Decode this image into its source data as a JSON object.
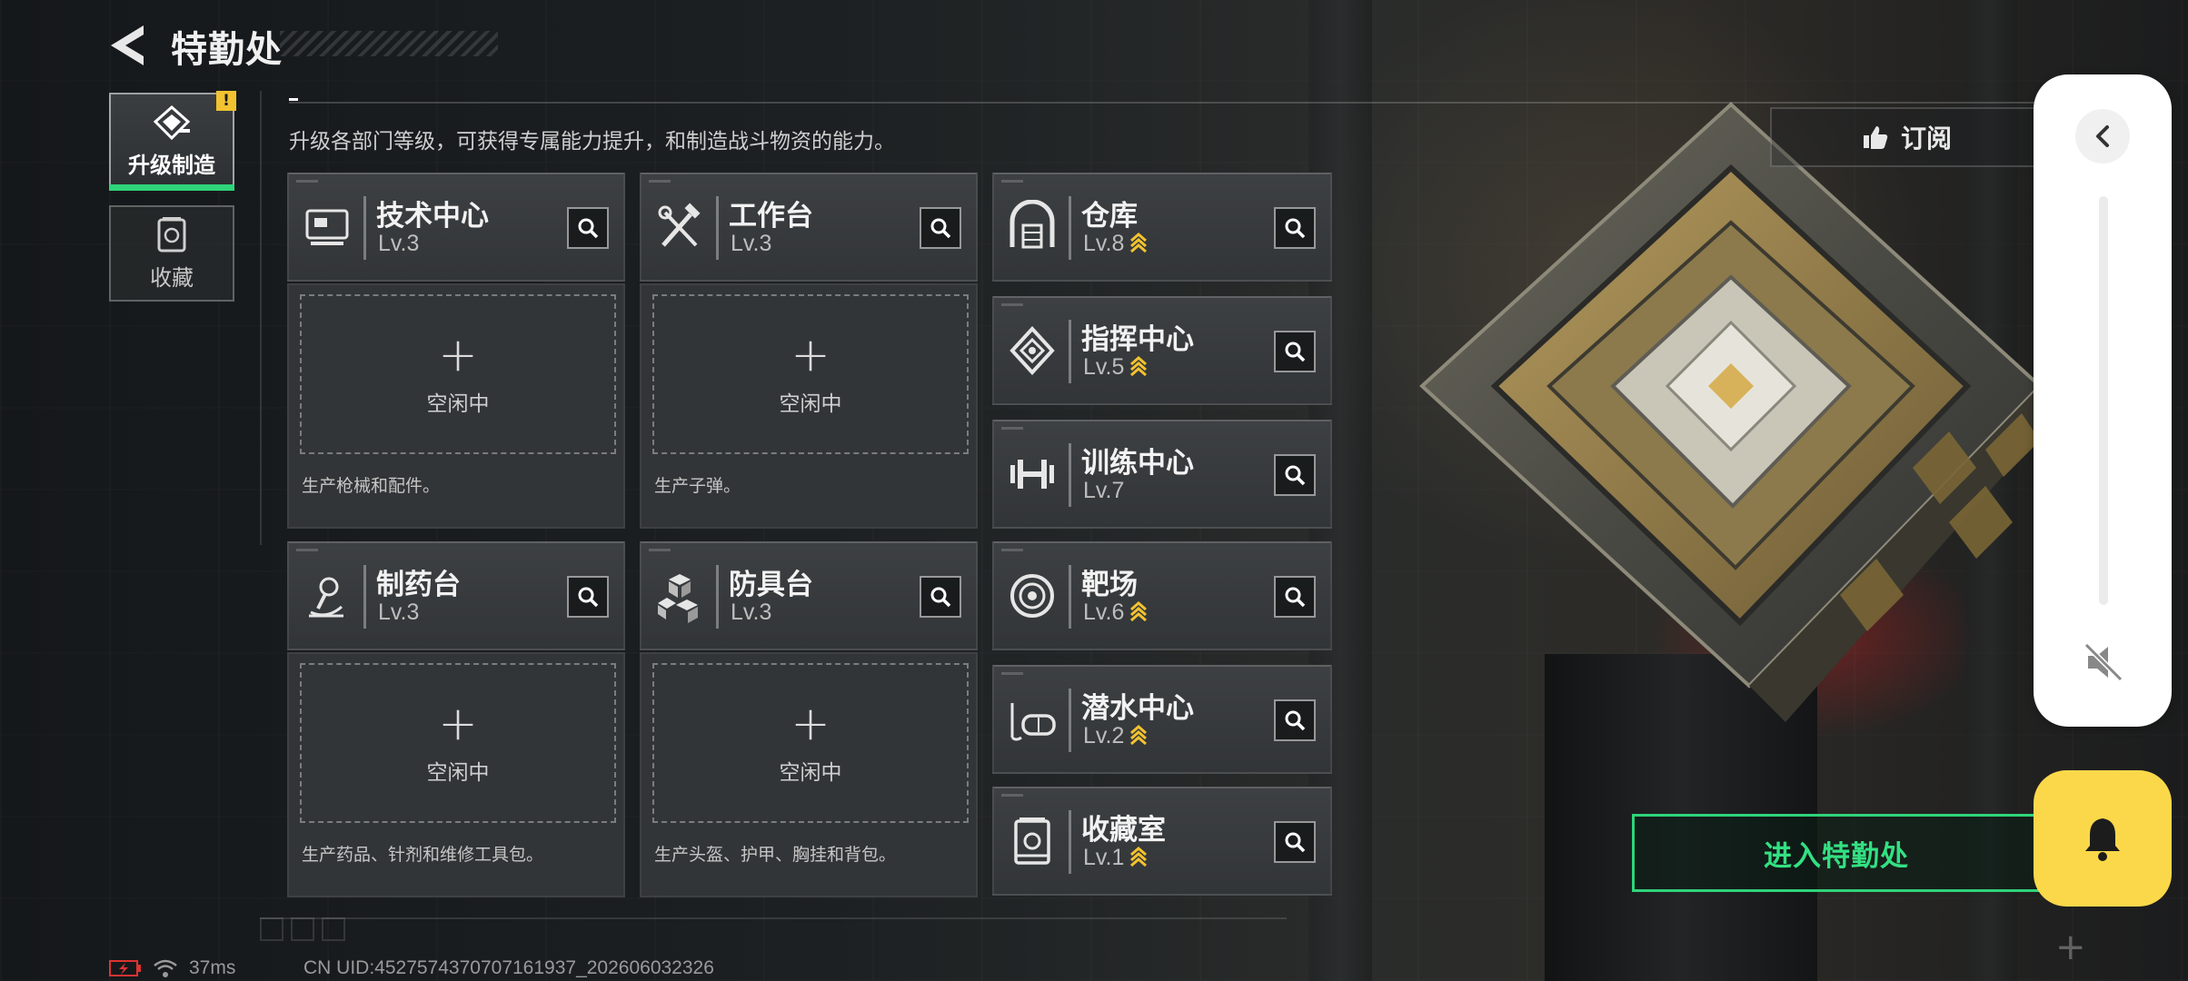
{
  "header": {
    "title": "特勤处",
    "description": "升级各部门等级，可获得专属能力提升，和制造战斗物资的能力。"
  },
  "side_tabs": [
    {
      "label": "升级制造",
      "active": true,
      "alert": "!"
    },
    {
      "label": "收藏",
      "active": false
    }
  ],
  "departments": {
    "tech_center": {
      "name": "技术中心",
      "level": "Lv.3",
      "icon": "computer-icon"
    },
    "workbench": {
      "name": "工作台",
      "level": "Lv.3",
      "icon": "tools-icon"
    },
    "warehouse": {
      "name": "仓库",
      "level": "Lv.8",
      "upgradable": true,
      "icon": "warehouse-icon"
    },
    "command_center": {
      "name": "指挥中心",
      "level": "Lv.5",
      "upgradable": true,
      "icon": "command-icon"
    },
    "training_center": {
      "name": "训练中心",
      "level": "Lv.7",
      "icon": "dumbbell-icon"
    },
    "pharmacy": {
      "name": "制药台",
      "level": "Lv.3",
      "icon": "microscope-icon"
    },
    "armor_bench": {
      "name": "防具台",
      "level": "Lv.3",
      "icon": "cubes-icon"
    },
    "shooting_range": {
      "name": "靶场",
      "level": "Lv.6",
      "upgradable": true,
      "icon": "target-icon"
    },
    "dive_center": {
      "name": "潜水中心",
      "level": "Lv.2",
      "upgradable": true,
      "icon": "dive-mask-icon"
    },
    "collection_room": {
      "name": "收藏室",
      "level": "Lv.1",
      "upgradable": true,
      "icon": "trophy-case-icon"
    }
  },
  "production_slots": {
    "tech_center": {
      "plus": "+",
      "status": "空闲中",
      "desc": "生产枪械和配件。"
    },
    "workbench": {
      "plus": "+",
      "status": "空闲中",
      "desc": "生产子弹。"
    },
    "pharmacy": {
      "plus": "+",
      "status": "空闲中",
      "desc": "生产药品、针剂和维修工具包。"
    },
    "armor_bench": {
      "plus": "+",
      "status": "空闲中",
      "desc": "生产头盔、护甲、胸挂和背包。"
    }
  },
  "actions": {
    "subscribe_label": "订阅",
    "enter_label": "进入特勤处"
  },
  "status": {
    "ping": "37ms",
    "uid": "CN UID:4527574370707161937_202606032326"
  },
  "colors": {
    "accent_green": "#2fd47a",
    "upgrade_gold": "#f2c230",
    "notify_yellow": "#fbd84a"
  }
}
